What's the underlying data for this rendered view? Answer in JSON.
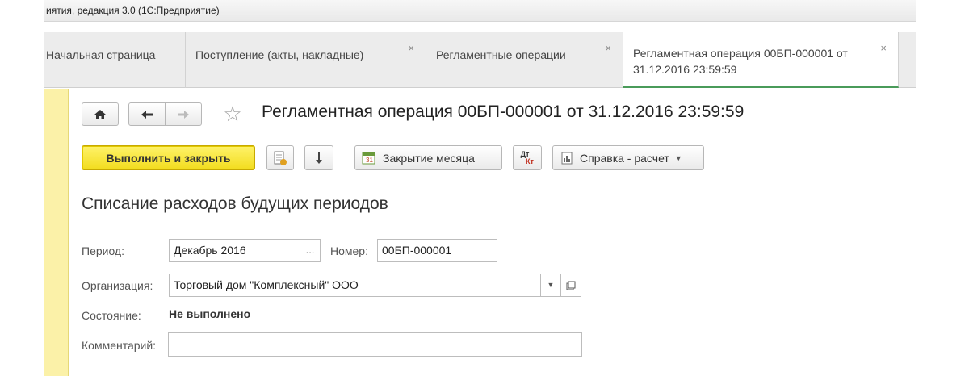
{
  "window": {
    "title": "иятия, редакция 3.0  (1С:Предприятие)"
  },
  "tabs": [
    {
      "label": "Начальная страница",
      "close": ""
    },
    {
      "label": "Поступление (акты, накладные)",
      "close": "×"
    },
    {
      "label": "Регламентные операции",
      "close": "×"
    },
    {
      "label": "Регламентная операция 00БП-000001 от 31.12.2016 23:59:59",
      "close": "×"
    }
  ],
  "header": {
    "title": "Регламентная операция 00БП-000001 от 31.12.2016 23:59:59"
  },
  "toolbar": {
    "execute_close_label": "Выполнить и закрыть",
    "close_month_label": "Закрытие месяца",
    "dtkt_top": "Дт",
    "dtkt_bottom": "Кт",
    "report_label": "Справка - расчет"
  },
  "form": {
    "section_title": "Списание расходов будущих периодов",
    "period_label": "Период:",
    "period_value": "Декабрь 2016",
    "period_select": "...",
    "number_label": "Номер:",
    "number_value": "00БП-000001",
    "org_label": "Организация:",
    "org_value": "Торговый дом \"Комплексный\" ООО",
    "status_label": "Состояние:",
    "status_value": "Не выполнено",
    "comment_label": "Комментарий:",
    "comment_value": ""
  },
  "colors": {
    "accent_yellow": "#f2dc1e",
    "active_tab_underline": "#4a9b5a",
    "left_stripe": "#fbf1a8"
  }
}
